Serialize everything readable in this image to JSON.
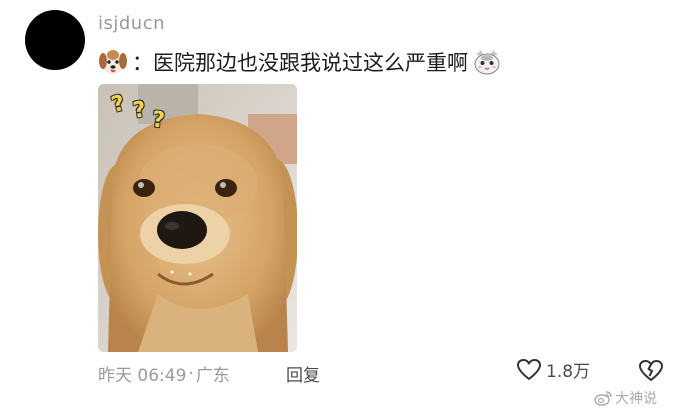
{
  "comment": {
    "username": "isjducn",
    "text": "：医院那边也没跟我说过这么严重啊",
    "prefix_emoji": "dog-face-emoji",
    "suffix_emoji": "cat-face-emoji",
    "image": {
      "subject": "golden-retriever-photo",
      "question_marks": [
        "?",
        "?",
        "?"
      ]
    },
    "meta": {
      "time": "昨天 06:49",
      "location": "广东"
    },
    "reply_label": "回复",
    "like_count": "1.8万",
    "like_icon": "heart-icon",
    "dislike_icon": "broken-heart-icon"
  },
  "watermark": {
    "text": "大神说",
    "icon": "weibo-icon"
  }
}
